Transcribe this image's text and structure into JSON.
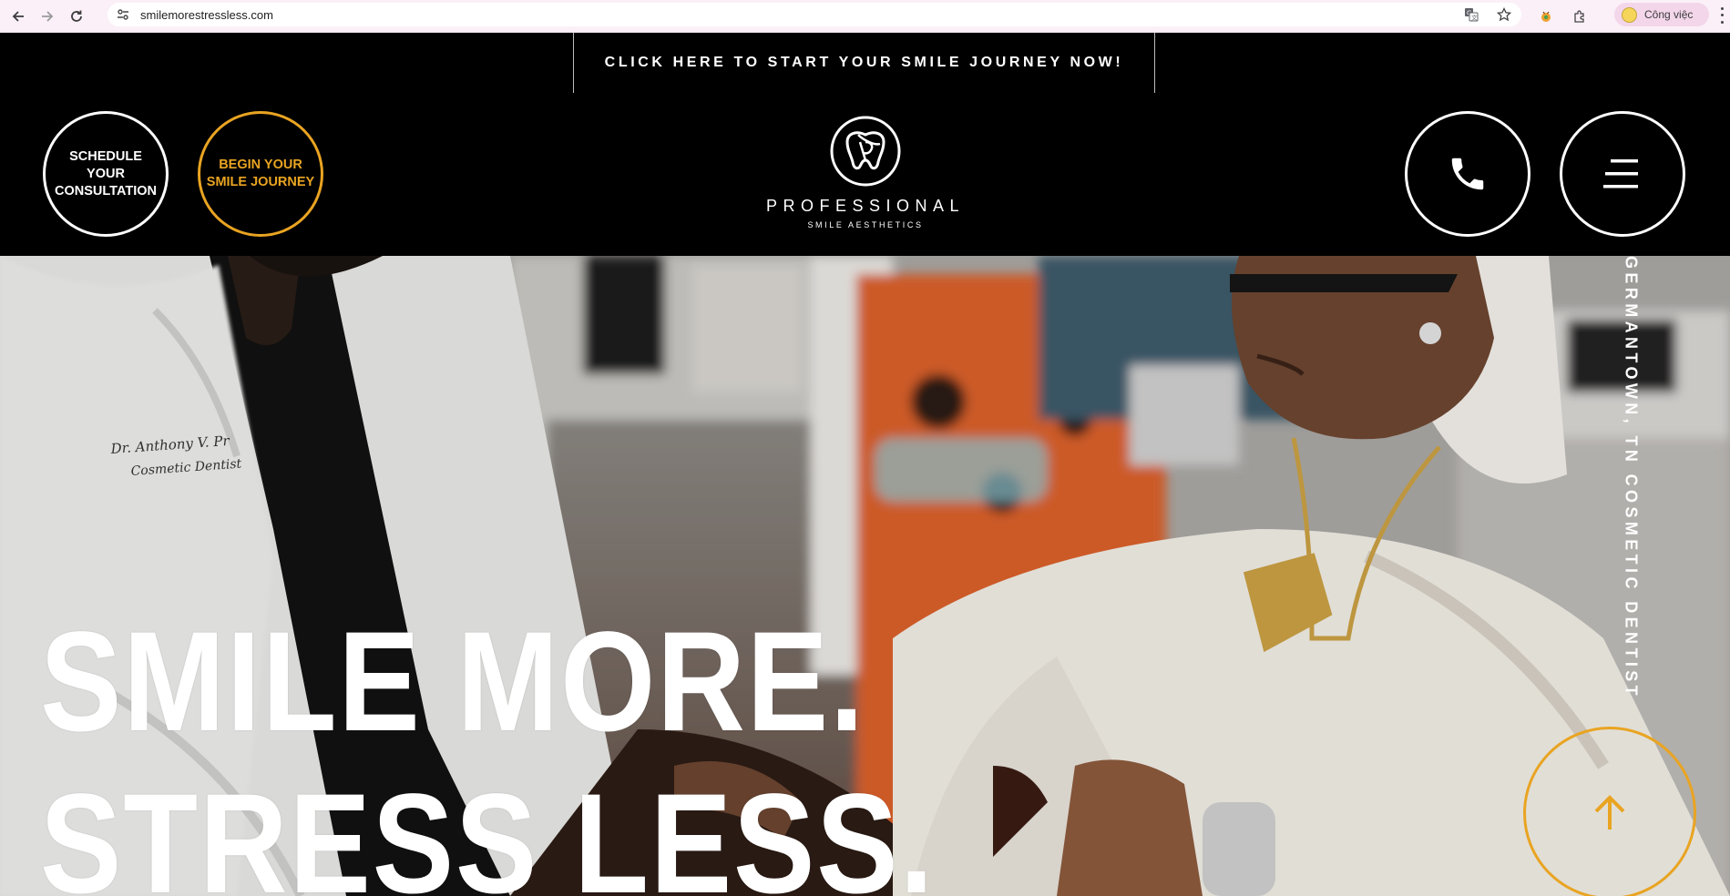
{
  "browser": {
    "url": "smilemorestressless.com",
    "profile_label": "Công việc"
  },
  "header": {
    "cta_banner": "CLICK HERE TO START YOUR SMILE JOURNEY NOW!",
    "schedule_button": "SCHEDULE YOUR CONSULTATION",
    "journey_button": "BEGIN YOUR SMILE JOURNEY",
    "logo_title": "PROFESSIONAL",
    "logo_subtitle": "SMILE AESTHETICS",
    "phone_icon": "phone-icon",
    "menu_icon": "hamburger-menu-icon"
  },
  "hero": {
    "headline_line1": "SMILE MORE.",
    "headline_line2": "STRESS LESS.",
    "location_tag": "GERMANTOWN, TN COSMETIC DENTIST",
    "coat_embroidery_line1": "Dr. Anthony V. Pr",
    "coat_embroidery_line2": "Cosmetic Dentist",
    "scroll_icon": "arrow-up-icon"
  },
  "colors": {
    "accent": "#e9a422",
    "background": "#000000",
    "text": "#ffffff"
  }
}
